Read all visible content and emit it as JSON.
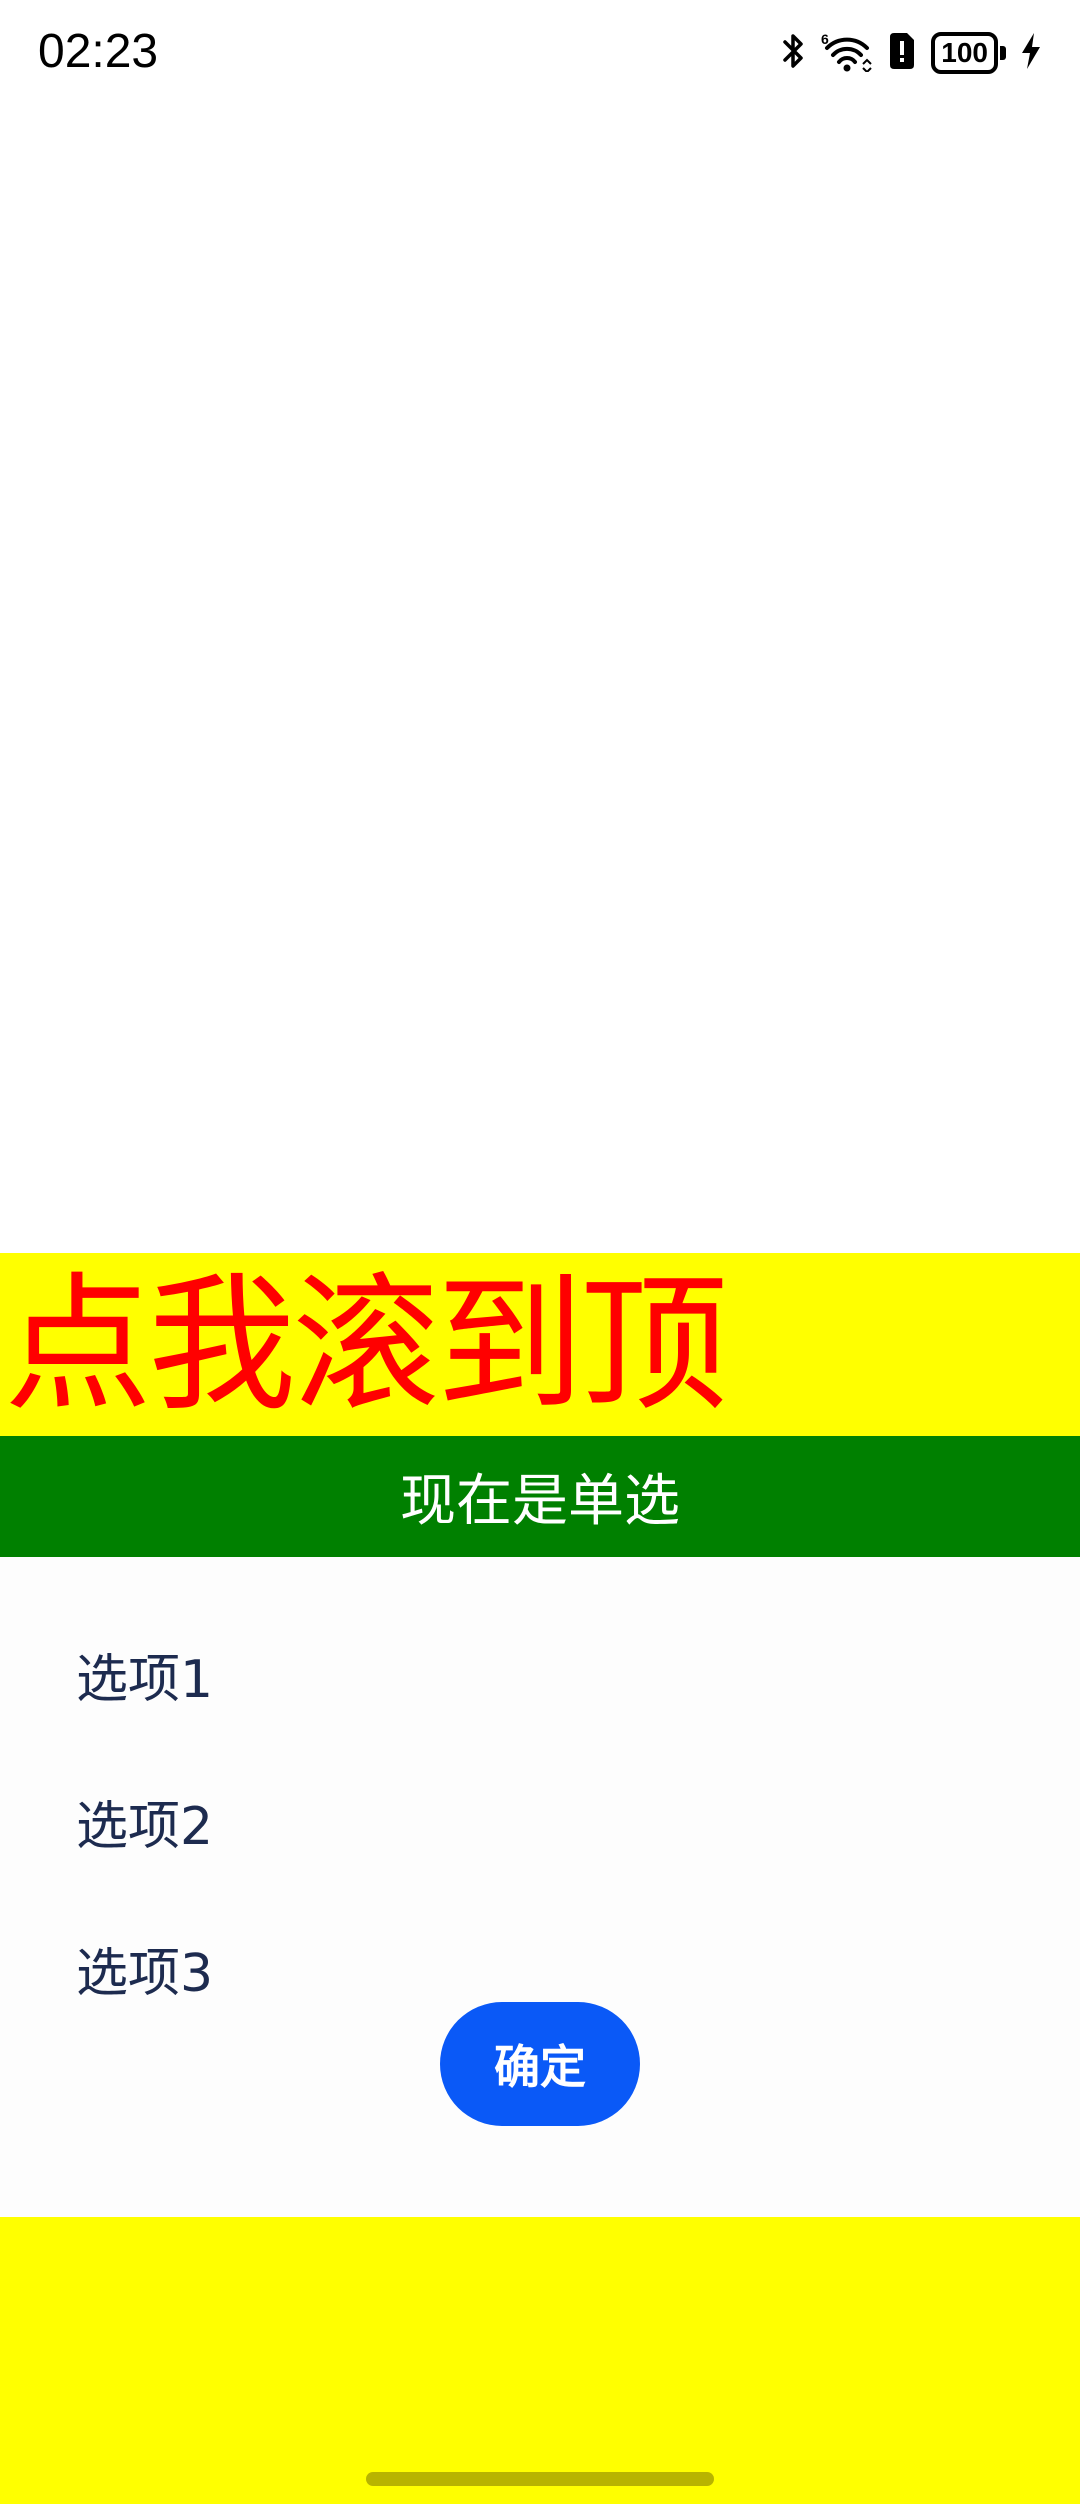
{
  "status_bar": {
    "time": "02:23",
    "battery_level": "100",
    "icons": [
      "bluetooth-icon",
      "wifi-6-icon",
      "sim-alert-icon",
      "battery-icon",
      "charging-bolt-icon"
    ]
  },
  "banner": {
    "scroll_top_label": "点我滚到顶",
    "background_color": "#ffff00",
    "text_color": "#ff0000"
  },
  "mode_bar": {
    "label": "现在是单选",
    "background_color": "#008000"
  },
  "options": {
    "items": [
      {
        "label": "选项1"
      },
      {
        "label": "选项2"
      },
      {
        "label": "选项3"
      }
    ]
  },
  "confirm": {
    "label": "确定",
    "color": "#0a59f7"
  }
}
